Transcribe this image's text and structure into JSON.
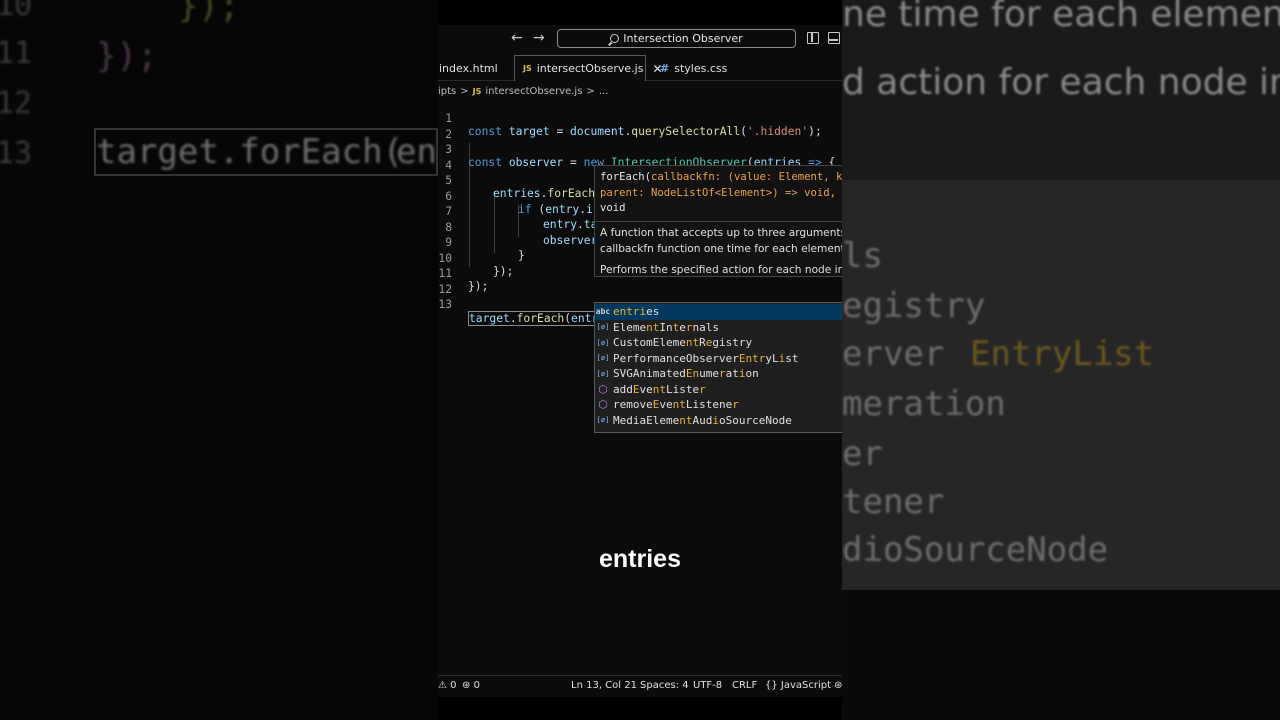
{
  "titlebar": {
    "search_text": "Intersection Observer"
  },
  "tabs": [
    {
      "label": "index.html"
    },
    {
      "label": "intersectObserve.js",
      "icon": "JS"
    },
    {
      "label": "styles.css",
      "icon": "#"
    }
  ],
  "breadcrumb": {
    "folder": "ipts",
    "sep": ">",
    "file": "intersectObserve.js",
    "more": "..."
  },
  "code_lines": {
    "n1": "1",
    "n2": "2",
    "n3": "3",
    "n4": "4",
    "n5": "5",
    "n6": "6",
    "n7": "7",
    "n8": "8",
    "n9": "9",
    "n10": "10",
    "n11": "11",
    "n12": "12",
    "n13": "13"
  },
  "hover": {
    "sig_line1_fn": "forEach(",
    "sig_line1_param": "callbackfn: (value: Element, ke",
    "sig_line2": "parent: NodeListOf<Element>) => void, t",
    "sig_line3": "void",
    "doc_line1": "A function that accepts up to three arguments. f",
    "doc_line2": "callbackfn function one time for each element in",
    "doc_line3": "Performs the specified action for each node in an"
  },
  "suggestions": [
    "entries",
    "ElementInternals",
    "CustomElementRegistry",
    "PerformanceObserverEntryList",
    "SVGAnimatedEnumeration",
    "addEventListener",
    "removeEventListener",
    "MediaElementAudioSourceNode"
  ],
  "statusbar": {
    "problems": "0",
    "ports": "0",
    "position": "Ln 13, Col 21",
    "spaces": "Spaces: 4",
    "encoding": "UTF-8",
    "eol": "CRLF",
    "language": "JavaScript"
  },
  "caption": "entries",
  "background": {
    "left_ln1": "10",
    "left_ln2": "11",
    "left_ln3": "12",
    "left_ln4": "13",
    "left_code1": "    });",
    "left_code2": "});",
    "left_code4a": "target.forEach(",
    "left_code4b": "ent",
    "right_hover1": "ne time for each element in",
    "right_hover2": "d action for each node in an",
    "right_s1": "ls",
    "right_s2": "egistry",
    "right_s3a": "erver",
    "right_s3b": "EntryList",
    "right_s4": "meration",
    "right_s5": "er",
    "right_s6": "tener",
    "right_s7": "dioSourceNode"
  }
}
